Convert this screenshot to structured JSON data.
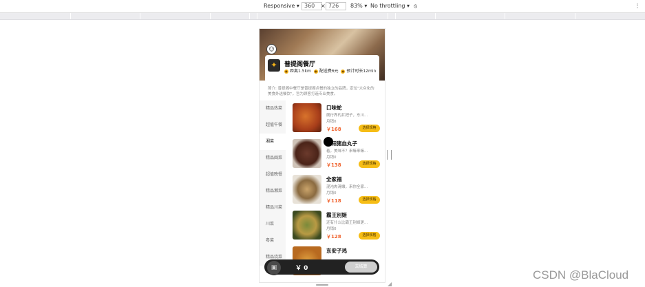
{
  "devtools": {
    "responsive_label": "Responsive",
    "width": "360",
    "times": "×",
    "height": "726",
    "zoom": "83%",
    "throttling": "No throttling",
    "rotate_icon": "⦸",
    "more_icon": "⋮"
  },
  "shop": {
    "name": "普提阁餐厅",
    "distance": "距离1.5km",
    "delivery_fee": "配送费6元",
    "eta": "预计时长12min",
    "intro": "简介: 普提阁中餐厅是普提阁点餐的独立的品牌，定位\"大众化的美食外送餐饮\"，旨为顾客打造专业美食。"
  },
  "sidebar": {
    "items": [
      "精品热菜",
      "超值午餐",
      "湘菜",
      "精品闽菜",
      "超值晚餐",
      "精品湘菜",
      "精品川菜",
      "川菜",
      "粤菜",
      "精品烧菜"
    ]
  },
  "dishes": [
    {
      "name": "口味蛇",
      "desc": "爬行界的扛把子，东川...",
      "sales": "月销0",
      "price": "￥168",
      "button": "选择规格"
    },
    {
      "name": "邵阳猪血丸子",
      "desc": "着，美味不？来嘛来嘛...",
      "sales": "月销0",
      "price": "￥138",
      "button": "选择规格"
    },
    {
      "name": "全家福",
      "desc": "混沌肉滑嫩，来你全家...",
      "sales": "月销0",
      "price": "￥118",
      "button": "选择规格"
    },
    {
      "name": "霸王别姬",
      "desc": "还有什么比霸王别姬更...",
      "sales": "月销0",
      "price": "￥128",
      "button": "选择规格"
    },
    {
      "name": "东安子鸡",
      "desc": "",
      "sales": "",
      "price": "",
      "button": ""
    }
  ],
  "cart": {
    "total": "￥ 0",
    "checkout": "去结算"
  },
  "watermark": "CSDN @BlaCloud",
  "colors": {
    "accent": "#f6bd16",
    "price": "#f0632e"
  }
}
